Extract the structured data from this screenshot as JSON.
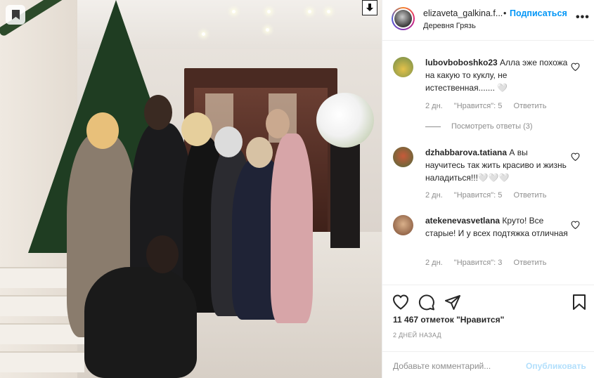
{
  "post": {
    "username": "elizaveta_galkina.f...",
    "separator": "•",
    "follow_label": "Подписаться",
    "location": "Деревня Грязь",
    "more_label": "•••"
  },
  "comments": [
    {
      "username": "lubovboboshko23",
      "text": " Алла эже похожа на какую то куклу, не истественная....... 🤍",
      "age": "2 дн.",
      "likes": "\"Нравится\": 5",
      "reply": "Ответить",
      "view_replies": "Посмотреть ответы (3)"
    },
    {
      "username": "dzhabbarova.tatiana",
      "text": " А вы научитесь так жить красиво и жизнь наладиться!!!🤍🤍🤍",
      "age": "2 дн.",
      "likes": "\"Нравится\": 5",
      "reply": "Ответить"
    },
    {
      "username": "atekenevasvetlana",
      "text": " Круто! Все старые! И у всех подтяжка отличная",
      "age": "2 дн.",
      "likes": "\"Нравится\": 3",
      "reply": "Ответить"
    }
  ],
  "footer": {
    "likes_count": "11 467 отметок \"Нравится\"",
    "date": "2 ДНЕЙ НАЗАД",
    "comment_placeholder": "Добавьте комментарий...",
    "publish_label": "Опубликовать"
  },
  "icons": {
    "like": "heart-icon",
    "comment": "comment-icon",
    "share": "share-icon",
    "save": "bookmark-icon",
    "download": "download-icon"
  },
  "colors": {
    "follow_blue": "#0095f6",
    "publish_disabled": "#b2dffc",
    "muted_text": "#8e8e8e",
    "text": "#262626"
  }
}
